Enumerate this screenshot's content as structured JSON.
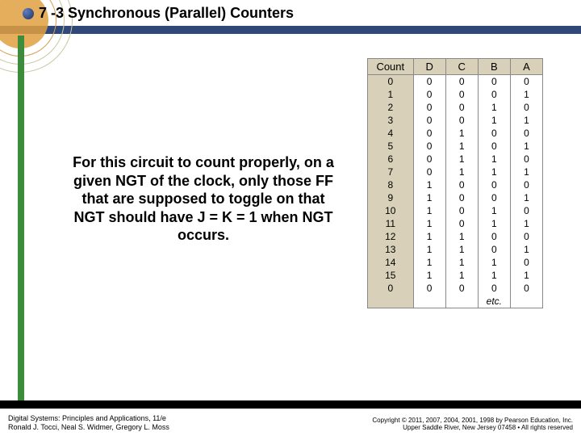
{
  "title": "7 -3 Synchronous (Parallel) Counters",
  "body_text": "For this circuit to count properly, on a given NGT of the clock, only those FF that are supposed to toggle on that NGT should have J = K = 1 when NGT occurs.",
  "table": {
    "headers": [
      "Count",
      "D",
      "C",
      "B",
      "A"
    ],
    "rows": [
      [
        "0",
        "0",
        "0",
        "0",
        "0"
      ],
      [
        "1",
        "0",
        "0",
        "0",
        "1"
      ],
      [
        "2",
        "0",
        "0",
        "1",
        "0"
      ],
      [
        "3",
        "0",
        "0",
        "1",
        "1"
      ],
      [
        "4",
        "0",
        "1",
        "0",
        "0"
      ],
      [
        "5",
        "0",
        "1",
        "0",
        "1"
      ],
      [
        "6",
        "0",
        "1",
        "1",
        "0"
      ],
      [
        "7",
        "0",
        "1",
        "1",
        "1"
      ],
      [
        "8",
        "1",
        "0",
        "0",
        "0"
      ],
      [
        "9",
        "1",
        "0",
        "0",
        "1"
      ],
      [
        "10",
        "1",
        "0",
        "1",
        "0"
      ],
      [
        "11",
        "1",
        "0",
        "1",
        "1"
      ],
      [
        "12",
        "1",
        "1",
        "0",
        "0"
      ],
      [
        "13",
        "1",
        "1",
        "0",
        "1"
      ],
      [
        "14",
        "1",
        "1",
        "1",
        "0"
      ],
      [
        "15",
        "1",
        "1",
        "1",
        "1"
      ],
      [
        "0",
        "0",
        "0",
        "0",
        "0"
      ]
    ],
    "etc_label": "etc."
  },
  "footer": {
    "left_line1": "Digital Systems: Principles and Applications, 11/e",
    "left_line2": "Ronald J. Tocci, Neal S. Widmer, Gregory L. Moss",
    "right_line1": "Copyright © 2011, 2007, 2004, 2001, 1998 by Pearson Education, Inc.",
    "right_line2": "Upper Saddle River, New Jersey 07458 • All rights reserved"
  }
}
